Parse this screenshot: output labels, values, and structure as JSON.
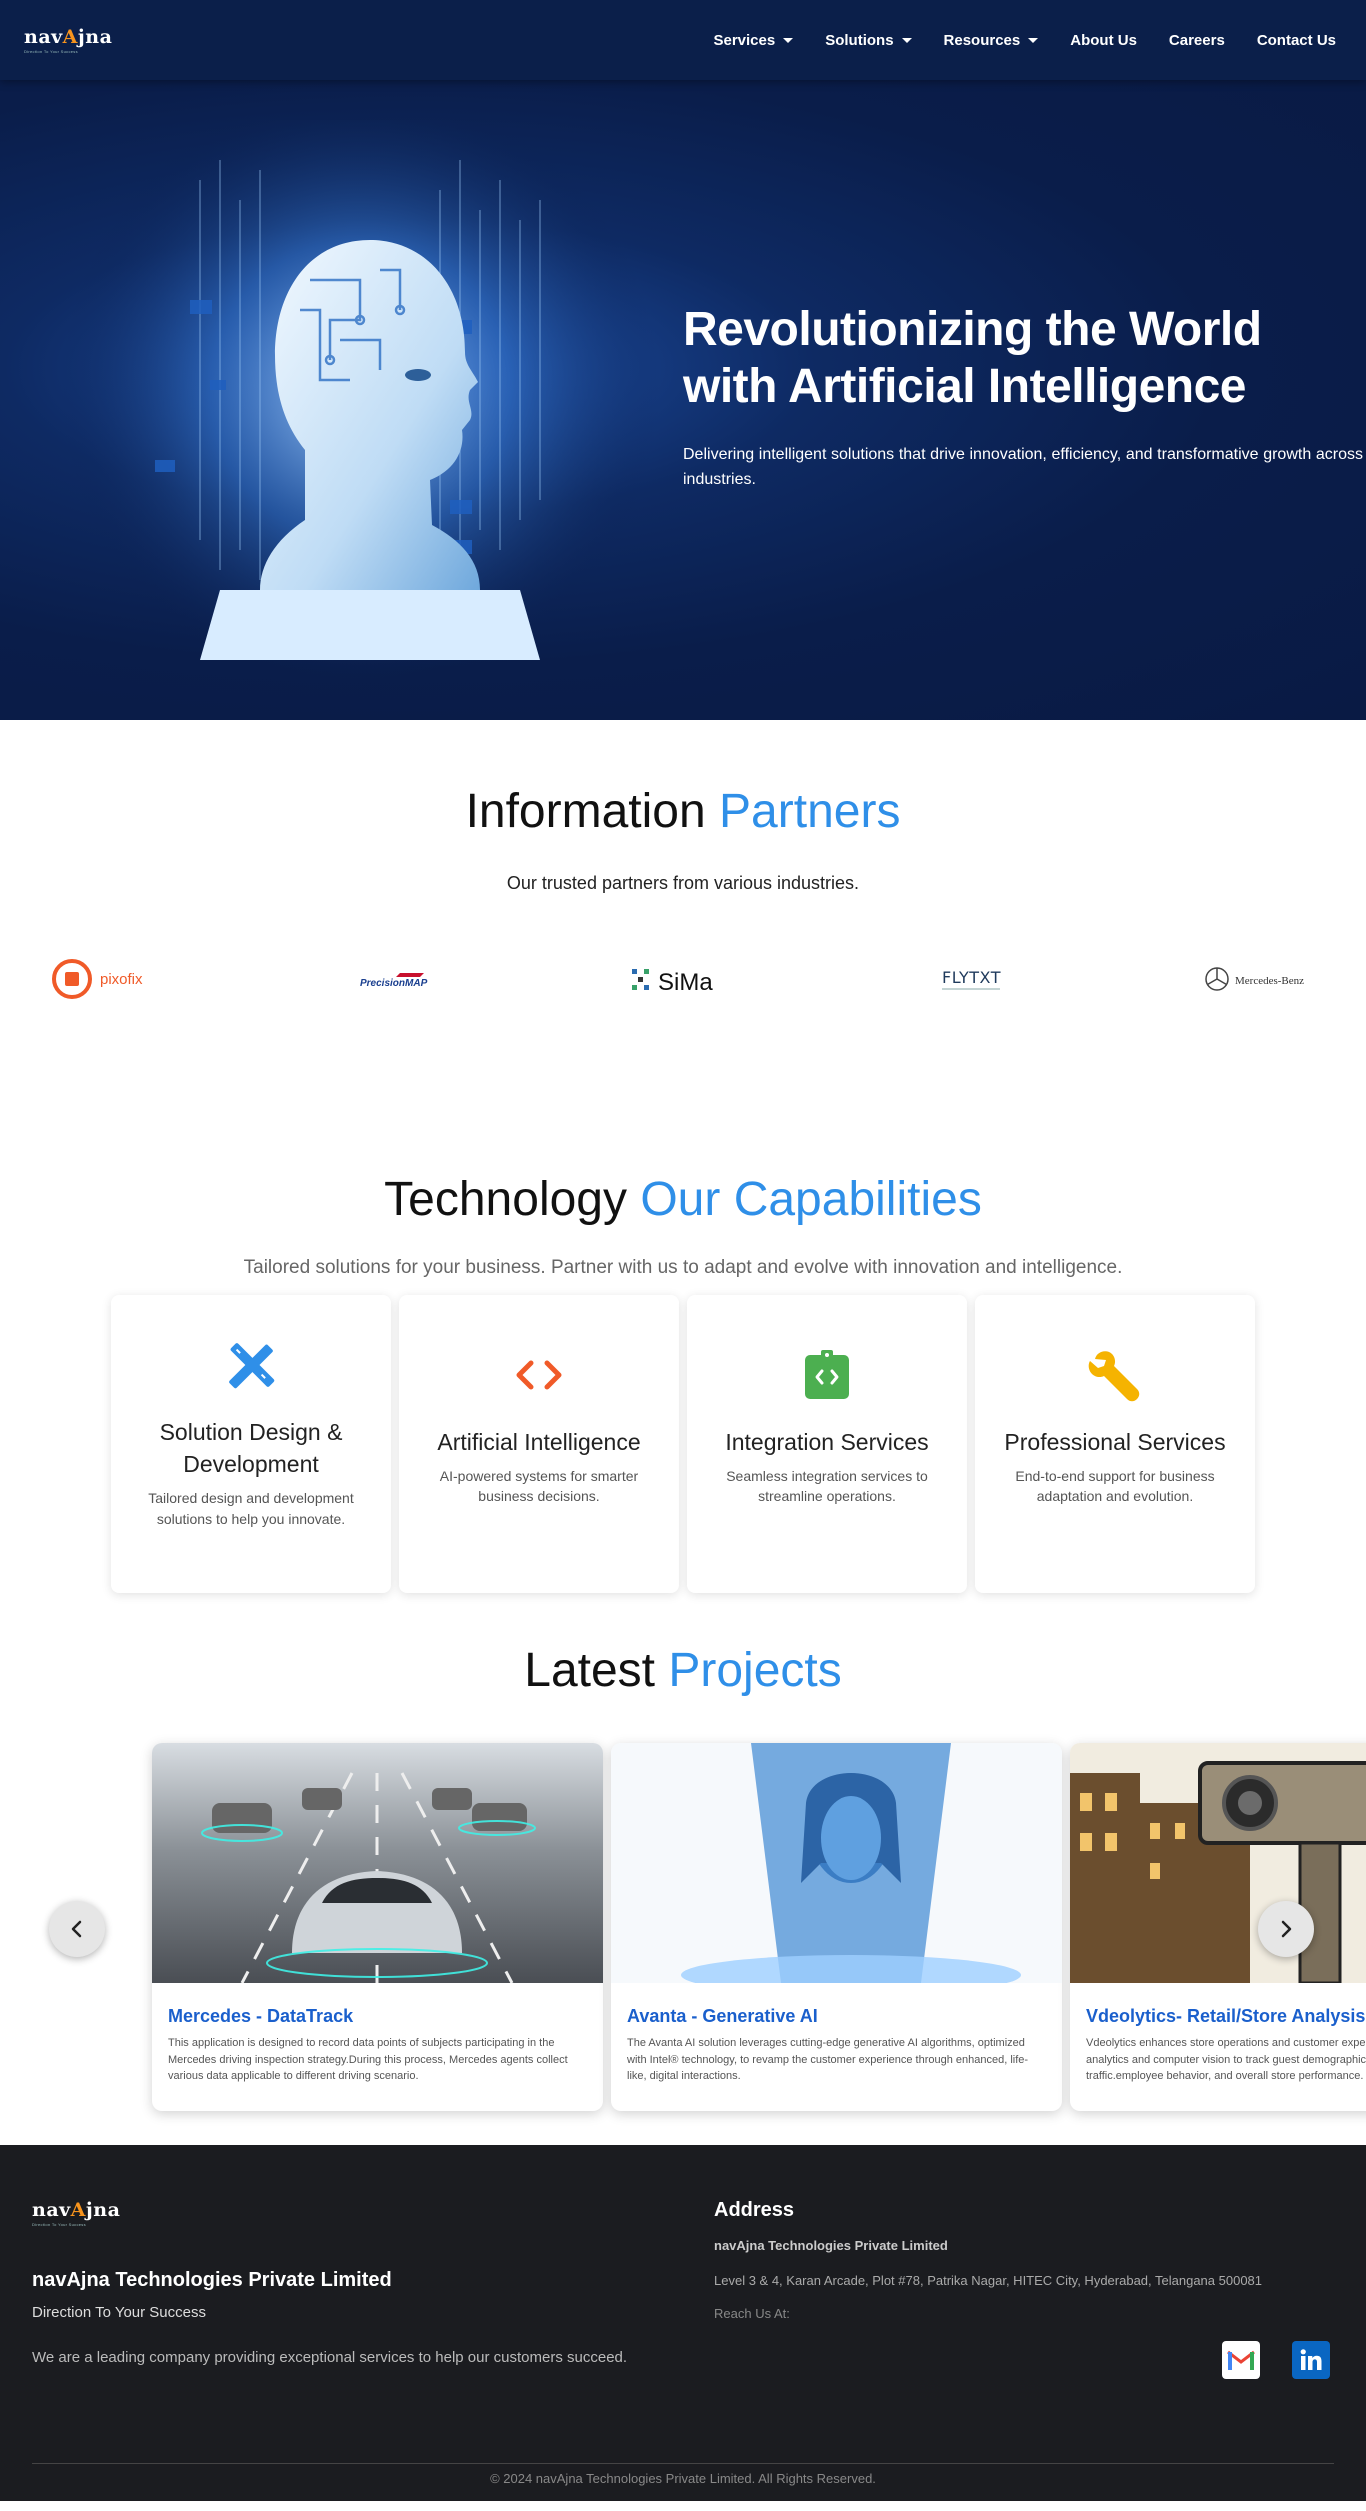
{
  "nav": {
    "logo_text_pre": "nav",
    "logo_text_mid": "A",
    "logo_text_post": "jna",
    "logo_tagline": "Direction To Your Success",
    "items": [
      {
        "label": "Services",
        "dropdown": true
      },
      {
        "label": "Solutions",
        "dropdown": true
      },
      {
        "label": "Resources",
        "dropdown": true
      },
      {
        "label": "About Us",
        "dropdown": false
      },
      {
        "label": "Careers",
        "dropdown": false
      },
      {
        "label": "Contact Us",
        "dropdown": false
      }
    ]
  },
  "hero": {
    "title": "Revolutionizing the World with Artificial Intelligence",
    "subtitle": "Delivering intelligent solutions that drive innovation, efficiency, and transformative growth across industries."
  },
  "partners": {
    "title_pre": "Information",
    "title_hl": "Partners",
    "subtitle": "Our trusted partners from various industries.",
    "logos": [
      {
        "name": "pixofix",
        "icon": "pixofix-logo"
      },
      {
        "name": "PrecisionMAP",
        "icon": "precisionmap-logo"
      },
      {
        "name": "SiMa",
        "icon": "sima-logo"
      },
      {
        "name": "FLYTXT",
        "icon": "flytxt-logo"
      },
      {
        "name": "Mercedes-Benz",
        "icon": "mercedes-benz-logo"
      }
    ]
  },
  "capabilities": {
    "title_pre": "Technology",
    "title_hl": "Our Capabilities",
    "subtitle": "Tailored solutions for your business. Partner with us to adapt and evolve with innovation and intelligence.",
    "cards": [
      {
        "title": "Solution Design & Development",
        "desc": "Tailored design and development solutions to help you innovate.",
        "icon": "design-tools-icon",
        "color": "#2f8fe8"
      },
      {
        "title": "Artificial Intelligence",
        "desc": "AI-powered systems for smarter business decisions.",
        "icon": "code-brackets-icon",
        "color": "#f05a28"
      },
      {
        "title": "Integration Services",
        "desc": "Seamless integration services to streamline operations.",
        "icon": "integration-icon",
        "color": "#4caf50"
      },
      {
        "title": "Professional Services",
        "desc": "End-to-end support for business adaptation and evolution.",
        "icon": "wrench-icon",
        "color": "#f5b301"
      }
    ]
  },
  "projects": {
    "title_pre": "Latest",
    "title_hl": "Projects",
    "cards": [
      {
        "title": "Mercedes - DataTrack",
        "desc": "This application is designed to record data points of subjects participating in the Mercedes driving inspection strategy.During this process, Mercedes agents collect various data applicable to different driving scenario."
      },
      {
        "title": "Avanta - Generative AI",
        "desc": "The Avanta AI solution leverages cutting-edge generative AI algorithms, optimized with Intel® technology, to revamp the customer experience through enhanced, life-like, digital interactions."
      },
      {
        "title": "Vdeolytics- Retail/Store Analysis",
        "desc": "Vdeolytics enhances store operations and customer experience with video-based analytics and computer vision to track guest demographics and monitor foot traffic.employee behavior, and overall store performance."
      }
    ]
  },
  "footer": {
    "company": "navAjna Technologies Private Limited",
    "tagline": "Direction To Your Success",
    "description": "We are a leading company providing exceptional services to help our customers succeed.",
    "address_heading": "Address",
    "address_company": "navAjna Technologies Private Limited",
    "address": "Level 3 & 4, Karan Arcade, Plot #78, Patrika Nagar, HITEC City, Hyderabad, Telangana 500081",
    "reach": "Reach Us At:",
    "copyright": "© 2024 navAjna Technologies Private Limited. All Rights Reserved."
  },
  "colors": {
    "nav_bg": "#0b1f4a",
    "accent": "#2f8fe8",
    "project_title": "#1a5fcc",
    "footer_bg": "#1b1c20"
  }
}
